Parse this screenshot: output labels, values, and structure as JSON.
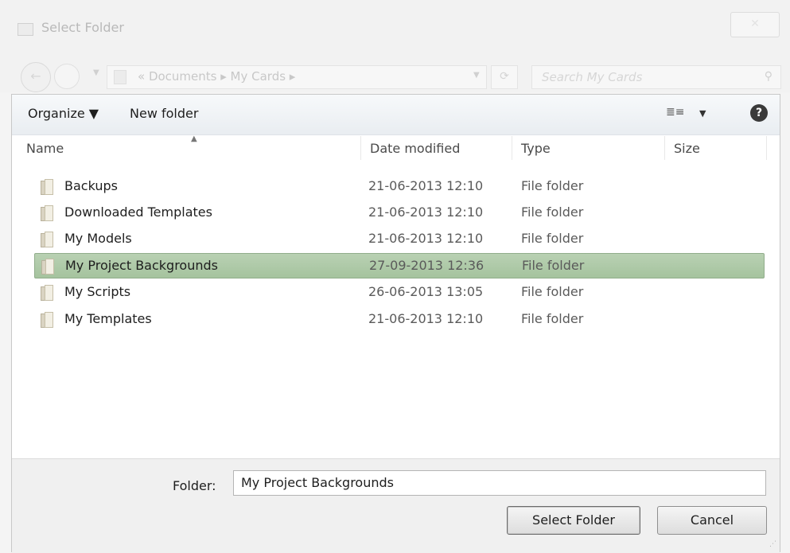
{
  "window": {
    "title": "Select Folder",
    "close_label": "✕"
  },
  "nav": {
    "breadcrumbs": "«  Documents  ▸  My Cards  ▸",
    "search_placeholder": "Search My Cards"
  },
  "toolbar": {
    "organize_label": "Organize ▼",
    "new_folder_label": "New folder",
    "view_icon": "≣≡",
    "view_drop": "▼",
    "help_label": "?"
  },
  "columns": {
    "name": "Name",
    "date_modified": "Date modified",
    "type": "Type",
    "size": "Size"
  },
  "files": [
    {
      "name": "Backups",
      "date": "21-06-2013 12:10",
      "type": "File folder"
    },
    {
      "name": "Downloaded Templates",
      "date": "21-06-2013 12:10",
      "type": "File folder"
    },
    {
      "name": "My Models",
      "date": "21-06-2013 12:10",
      "type": "File folder"
    },
    {
      "name": "My Project Backgrounds",
      "date": "27-09-2013 12:36",
      "type": "File folder"
    },
    {
      "name": "My Scripts",
      "date": "26-06-2013 13:05",
      "type": "File folder"
    },
    {
      "name": "My Templates",
      "date": "21-06-2013 12:10",
      "type": "File folder"
    }
  ],
  "selected_index": 3,
  "footer": {
    "folder_label": "Folder:",
    "folder_value": "My Project Backgrounds",
    "select_label": "Select Folder",
    "cancel_label": "Cancel"
  },
  "colors": {
    "selection": "#a9c6a2"
  }
}
